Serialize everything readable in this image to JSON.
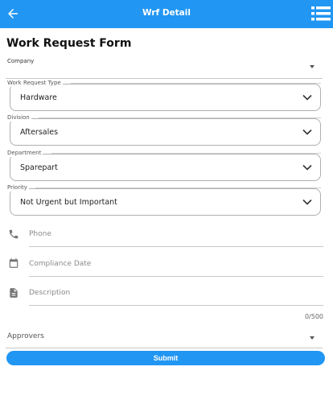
{
  "appbar": {
    "title": "Wrf Detail",
    "back_icon": "arrow-left-icon",
    "menu_icon": "list-menu-icon",
    "color": "#2196f3"
  },
  "form": {
    "title": "Work Request Form",
    "company": {
      "label": "Company"
    },
    "work_request_type": {
      "label": "Work Request Type",
      "value": "Hardware"
    },
    "division": {
      "label": "Division",
      "value": "Aftersales"
    },
    "department": {
      "label": "Department",
      "value": "Sparepart"
    },
    "priority": {
      "label": "Priority",
      "value": "Not Urgent but Important"
    },
    "phone": {
      "placeholder": "Phone",
      "icon": "phone-icon"
    },
    "compliance_date": {
      "placeholder": "Compliance Date",
      "icon": "calendar-icon"
    },
    "description": {
      "placeholder": "Description",
      "icon": "document-icon",
      "counter": "0/500"
    },
    "approvers": {
      "label": "Approvers"
    },
    "submit_label": "Submit"
  }
}
